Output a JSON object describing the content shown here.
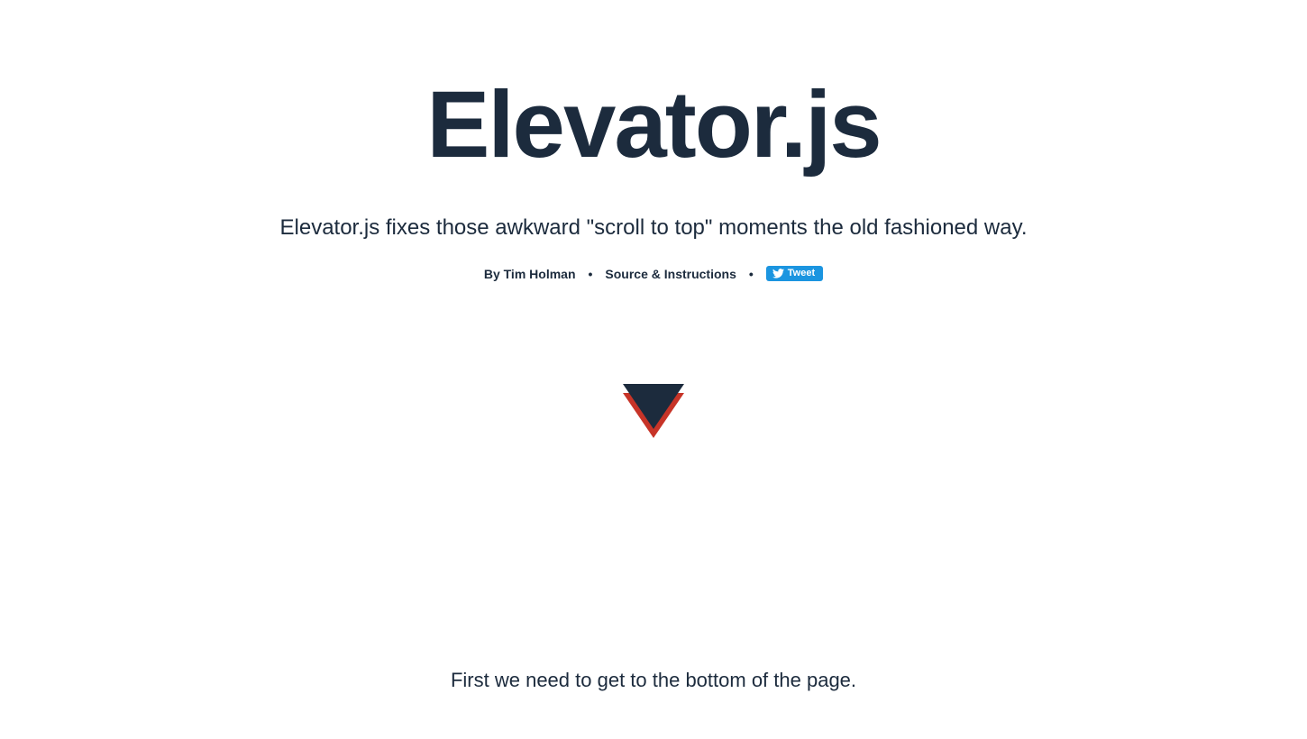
{
  "title": "Elevator.js",
  "tagline": "Elevator.js fixes those awkward \"scroll to top\" moments the old fashioned way.",
  "meta": {
    "author": "By Tim Holman",
    "source": "Source & Instructions",
    "separator": "•",
    "tweet": "Tweet"
  },
  "bottom": "First we need to get to the bottom of the page.",
  "colors": {
    "dark": "#1c2b3d",
    "red": "#c73428",
    "twitter": "#1b95e0"
  }
}
